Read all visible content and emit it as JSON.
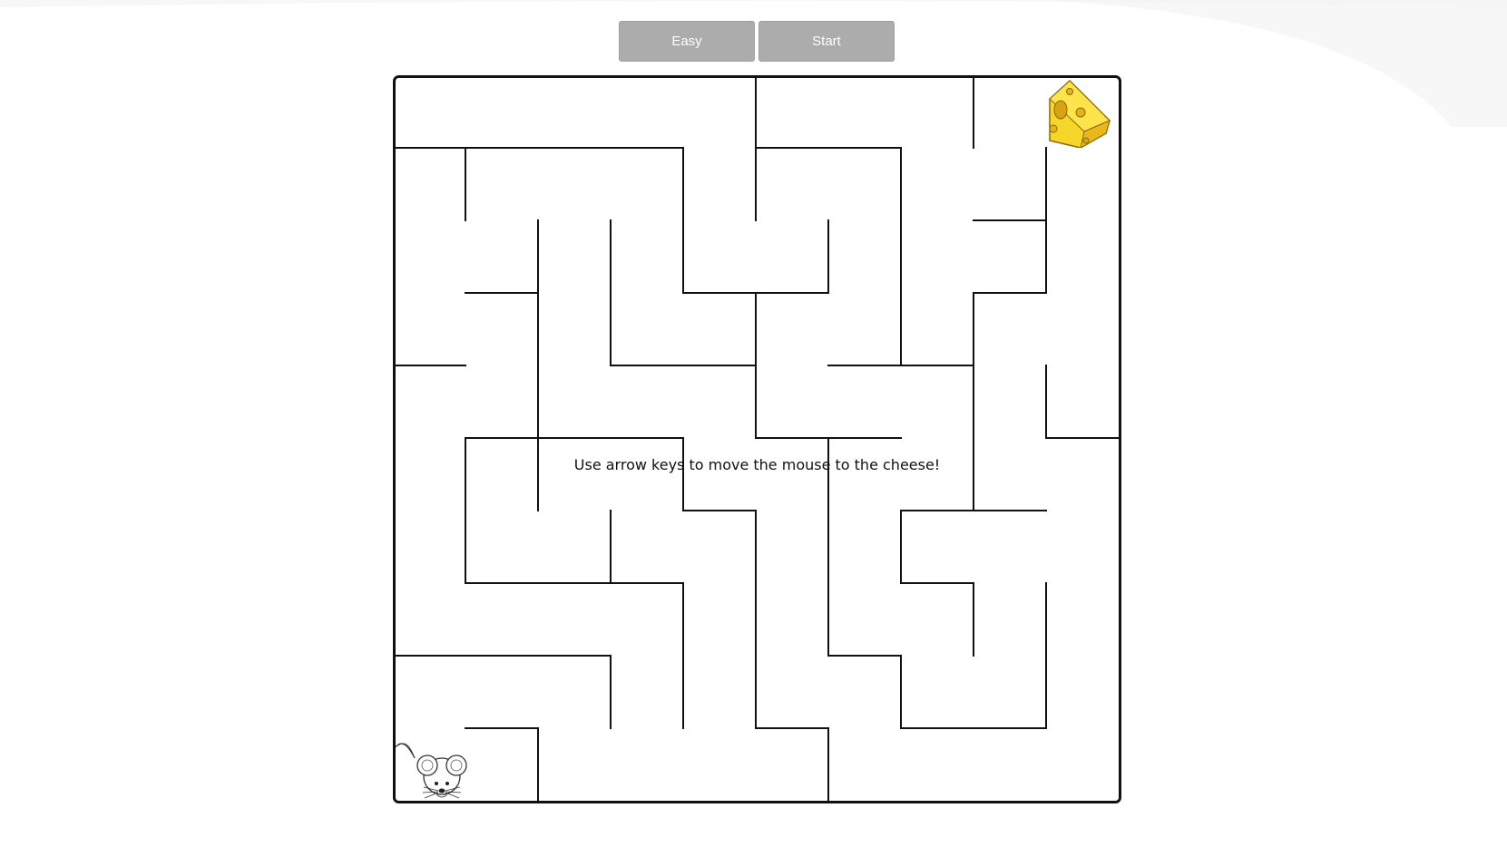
{
  "toolbar": {
    "difficulty_label": "Easy",
    "start_label": "Start"
  },
  "game": {
    "instructions": "Use arrow keys to move the mouse to the cheese!",
    "grid_size": 10,
    "player": {
      "name": "mouse",
      "icon": "mouse-icon",
      "col": 0,
      "row": 9
    },
    "goal": {
      "name": "cheese",
      "icon": "cheese-icon",
      "col": 9,
      "row": 0
    },
    "colors": {
      "wall": "#111111",
      "button_bg": "#acacac",
      "button_text": "#ffffff",
      "cheese": "#f7d62a"
    }
  }
}
